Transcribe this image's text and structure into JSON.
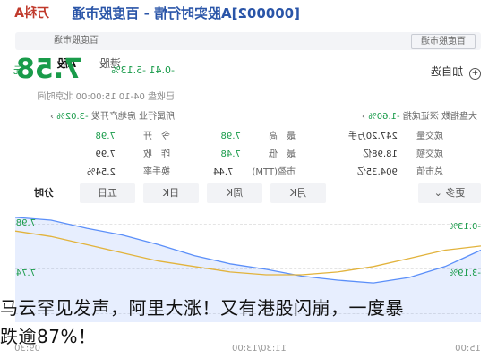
{
  "header": {
    "title": "[000002]A股实时行情 - 百度股市通",
    "brand": "万科A"
  },
  "search": {
    "placeholder_pill": "百度股市通",
    "right_pill": "百度股市通"
  },
  "market_tabs": [
    {
      "label": "A股",
      "active": true
    },
    {
      "label": "港股",
      "active": false
    }
  ],
  "watchlist_label": "加自选",
  "quote": {
    "price": "7.58",
    "unit": "元",
    "change": "-0.41 -5.13%"
  },
  "status_line": "已收盘 04-10 15:00:00 北京时间",
  "sector_line": {
    "prefix": "所属行业 房地产开发",
    "value": "-3.02%"
  },
  "market_index": {
    "label": "大盘指数 深证成指",
    "value": "-1.60%"
  },
  "stats": {
    "rows": [
      [
        {
          "label": "今　开",
          "value": "7.98",
          "color": "green"
        },
        {
          "label": "最　高",
          "value": "7.98",
          "color": "green"
        },
        {
          "label": "成交量",
          "value": "247.20万手",
          "color": "normal"
        }
      ],
      [
        {
          "label": "昨　收",
          "value": "7.99",
          "color": "normal"
        },
        {
          "label": "最　低",
          "value": "7.48",
          "color": "green"
        },
        {
          "label": "成交额",
          "value": "18.98亿",
          "color": "normal"
        }
      ],
      [
        {
          "label": "换手率",
          "value": "2.54%",
          "color": "normal"
        },
        {
          "label": "市盈(TTM)",
          "value": "7.44",
          "color": "normal"
        },
        {
          "label": "总市值",
          "value": "904.35亿",
          "color": "normal"
        }
      ]
    ]
  },
  "chart_tabs": [
    {
      "label": "分时",
      "active": true
    },
    {
      "label": "五日",
      "active": false
    },
    {
      "label": "日K",
      "active": false
    },
    {
      "label": "周K",
      "active": false
    },
    {
      "label": "月K",
      "active": false
    },
    {
      "label": "更多",
      "active": false
    }
  ],
  "chart_labels": {
    "y_top_left": "7.98",
    "y_top_right": "-0.13%",
    "y_bottom_left": "7.74",
    "y_bottom_right": "-3.19%",
    "time_start": "09:30",
    "time_mid": "11:30/13:00",
    "time_end": "15:00"
  },
  "chart_data": {
    "type": "line",
    "title": "",
    "xlabel": "",
    "ylabel": "",
    "x": [
      "09:30",
      "11:30/13:00",
      "15:00"
    ],
    "series": [
      {
        "name": "",
        "values": [
          7.74,
          7.62,
          7.54,
          7.5,
          7.52,
          7.55,
          7.6,
          7.64,
          7.7,
          7.78,
          7.85,
          7.9,
          7.96,
          7.98
        ]
      },
      {
        "name": "",
        "values": [
          7.77,
          7.74,
          7.68,
          7.62,
          7.58,
          7.56,
          7.56,
          7.58,
          7.62,
          7.66,
          7.72,
          7.78,
          7.84,
          7.88
        ]
      }
    ],
    "ylim": [
      7.74,
      7.98
    ],
    "grid": true
  },
  "headline": {
    "line1": "马云罕见发声，阿里大涨！又有港股闪崩，一度暴",
    "line2": "跌逾87%！"
  }
}
